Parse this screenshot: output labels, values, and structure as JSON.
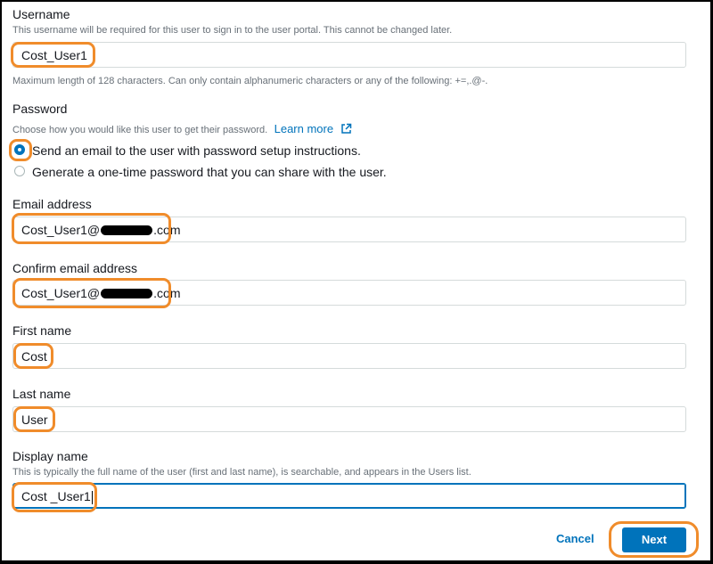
{
  "username": {
    "label": "Username",
    "description": "This username will be required for this user to sign in to the user portal. This cannot be changed later.",
    "value": "Cost_User1",
    "hint": "Maximum length of 128 characters. Can only contain alphanumeric characters or any of the following: +=,.@-."
  },
  "password": {
    "label": "Password",
    "description": "Choose how you would like this user to get their password.",
    "learn_more": "Learn more",
    "options": [
      {
        "label": "Send an email to the user with password setup instructions.",
        "selected": true
      },
      {
        "label": "Generate a one-time password that you can share with the user.",
        "selected": false
      }
    ]
  },
  "email": {
    "label": "Email address",
    "value_prefix": "Cost_User1@",
    "value_suffix": ".com"
  },
  "confirm_email": {
    "label": "Confirm email address",
    "value_prefix": "Cost_User1@",
    "value_suffix": ".com"
  },
  "first_name": {
    "label": "First name",
    "value": "Cost"
  },
  "last_name": {
    "label": "Last name",
    "value": "User"
  },
  "display_name": {
    "label": "Display name",
    "description": "This is typically the full name of the user (first and last name), is searchable, and appears in the Users list.",
    "value": "Cost _User1"
  },
  "actions": {
    "cancel": "Cancel",
    "next": "Next"
  },
  "colors": {
    "primary": "#0073bb",
    "highlight": "#f08c2b"
  },
  "icons": {
    "external_link": "external-link-icon"
  }
}
